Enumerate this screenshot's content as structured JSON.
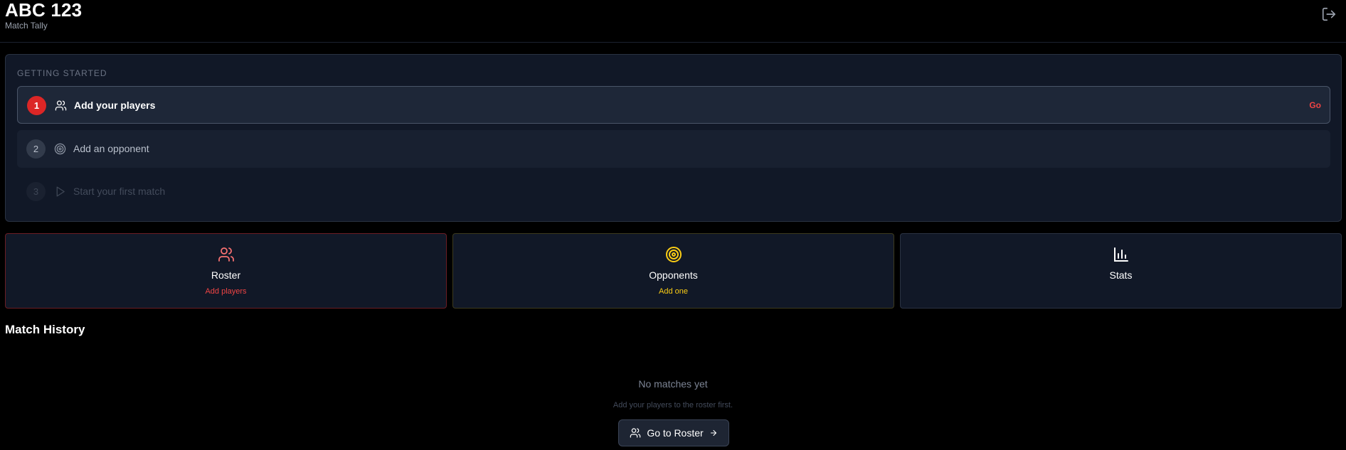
{
  "header": {
    "title": "ABC 123",
    "subtitle": "Match Tally",
    "logout_icon": "logout-icon"
  },
  "getting_started": {
    "label": "GETTING STARTED",
    "steps": [
      {
        "number": "1",
        "icon": "users-icon",
        "label": "Add your players",
        "action": "Go",
        "state": "active"
      },
      {
        "number": "2",
        "icon": "target-icon",
        "label": "Add an opponent",
        "state": "pending"
      },
      {
        "number": "3",
        "icon": "play-icon",
        "label": "Start your first match",
        "state": "disabled"
      }
    ]
  },
  "tiles": [
    {
      "title": "Roster",
      "subtitle": "Add players",
      "icon": "users-icon",
      "accent": "#ef4444"
    },
    {
      "title": "Opponents",
      "subtitle": "Add one",
      "icon": "target-icon",
      "accent": "#facc15"
    },
    {
      "title": "Stats",
      "subtitle": "",
      "icon": "bar-chart-icon",
      "accent": "#ffffff"
    }
  ],
  "match_history": {
    "title": "Match History",
    "empty_title": "No matches yet",
    "empty_subtitle": "Add your players to the roster first.",
    "button_label": "Go to Roster"
  },
  "colors": {
    "background": "#000000",
    "card": "#111827",
    "primary_red": "#dc2626",
    "accent_yellow": "#facc15"
  }
}
